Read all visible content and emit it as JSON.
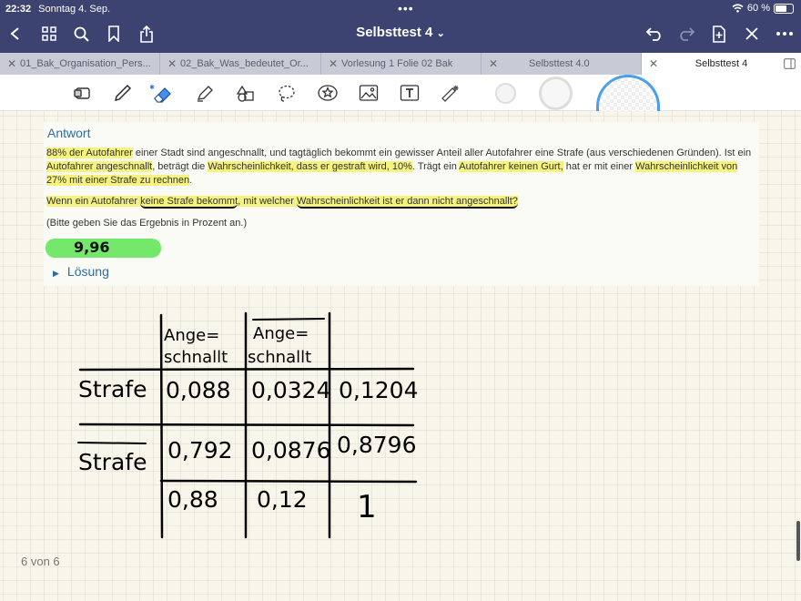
{
  "status": {
    "time": "22:32",
    "date": "Sonntag 4. Sep.",
    "battery": "60 %"
  },
  "header": {
    "title": "Selbsttest 4",
    "title_chevron": "⌄"
  },
  "tabs": [
    {
      "label": "01_Bak_Organisation_Pers..."
    },
    {
      "label": "02_Bak_Was_bedeutet_Or..."
    },
    {
      "label": "Vorlesung 1 Folie 02 Bak"
    },
    {
      "label": "Selbsttest 4.0"
    },
    {
      "label": "Selbsttest 4"
    }
  ],
  "toolbar": {
    "tools": [
      "lasso-select-icon",
      "pen-icon",
      "eraser-icon",
      "highlighter-icon",
      "shapes-icon",
      "lasso-icon",
      "sticker-icon",
      "image-icon",
      "text-icon",
      "laser-pointer-icon"
    ]
  },
  "question": {
    "heading": "Antwort",
    "p1": [
      {
        "t": "88% der Autofahrer",
        "hl": true
      },
      {
        "t": " einer Stadt sind angeschnallt, und tagtäglich bekommt ein gewisser Anteil aller Autofahrer eine Strafe (aus verschiedenen Gründen). Ist ein "
      },
      {
        "t": "Autofahrer angeschnallt",
        "hl": true
      },
      {
        "t": ", beträgt die "
      },
      {
        "t": "Wahrscheinlichkeit, dass er gestraft wird, 10%",
        "hl": true
      },
      {
        "t": ". Trägt ein "
      },
      {
        "t": "Autofahrer keinen Gurt,",
        "hl": true
      },
      {
        "t": " hat er mit einer "
      },
      {
        "t": "Wahrscheinlichkeit von 27% mit einer Strafe zu rechnen",
        "hl": true
      },
      {
        "t": "."
      }
    ],
    "p2": [
      {
        "t": "Wenn ein Autofahrer ",
        "hl": true
      },
      {
        "t": "keine Strafe bekommt",
        "hl": true,
        "ul": true
      },
      {
        "t": ", mit welcher ",
        "hl": true
      },
      {
        "t": "Wahrscheinlichkeit ist er dann nicht angeschnallt?",
        "hl": true,
        "ul": true
      }
    ],
    "hint": "(Bitte geben Sie das Ergebnis in Prozent an.)",
    "answer": "9,96",
    "solution_label": "Lösung"
  },
  "table": {
    "col_headers": [
      "Ange=\nschnallt",
      "Ange=\nschnallt"
    ],
    "row_headers": [
      "Strafe",
      "Strafe",
      ""
    ],
    "rows": [
      [
        "0,088",
        "0,0324",
        "0,1204"
      ],
      [
        "0,792",
        "0,0876",
        "0,8796"
      ],
      [
        "0,88",
        "0,12",
        "1"
      ]
    ]
  },
  "footer": {
    "page_indicator": "6 von 6"
  },
  "colors": {
    "header_bg": "#3c4371",
    "highlight": "#f5f27d",
    "answer_field": "#74e86b",
    "link": "#2e6ca8"
  }
}
